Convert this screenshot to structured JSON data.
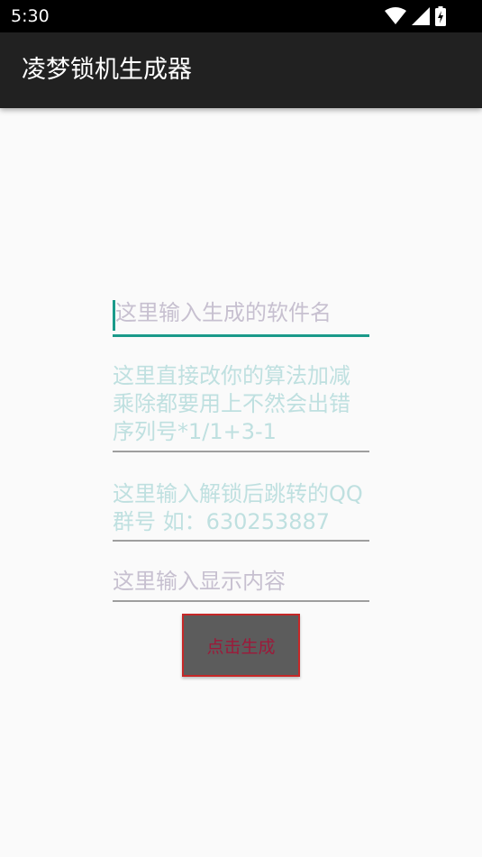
{
  "status_bar": {
    "time": "5:30",
    "icons": [
      "wifi-icon",
      "signal-icon",
      "battery-charging-icon"
    ]
  },
  "app_bar": {
    "title": "凌梦锁机生成器"
  },
  "form": {
    "app_name_placeholder": "这里输入生成的软件名",
    "algorithm_placeholder": "这里直接改你的算法加减乘除都要用上不然会出错 序列号*1/1+3-1",
    "qq_group_placeholder": "这里输入解锁后跳转的QQ群号 如：630253887",
    "display_content_placeholder": "这里输入显示内容",
    "generate_button_label": "点击生成"
  },
  "colors": {
    "accent": "#1a9a8a",
    "app_bar": "#212121",
    "status_bar": "#000000",
    "background": "#fafafa",
    "button_fill": "#5c5c5c",
    "button_border": "#c62828",
    "button_text": "#9c1a3a"
  }
}
